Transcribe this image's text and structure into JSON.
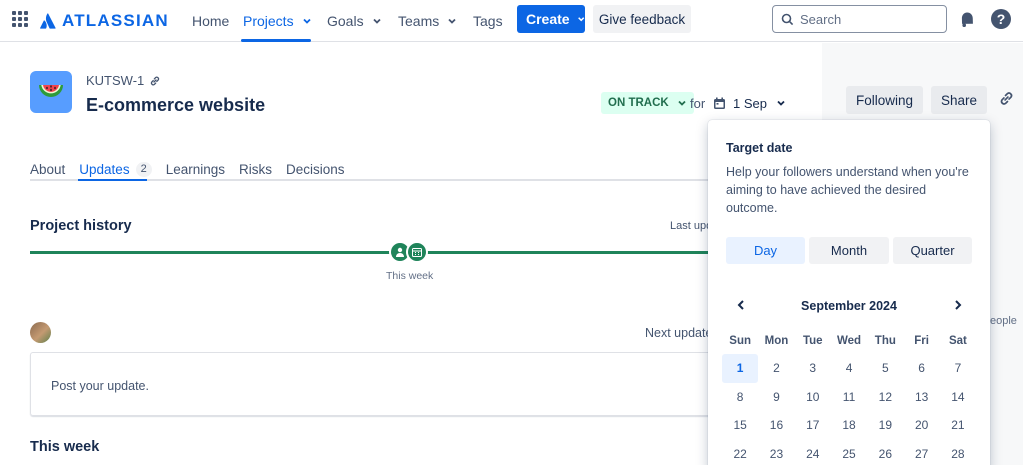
{
  "nav": {
    "logo": "ATLASSIAN",
    "items": [
      {
        "label": "Home"
      },
      {
        "label": "Projects"
      },
      {
        "label": "Goals"
      },
      {
        "label": "Teams"
      },
      {
        "label": "Tags"
      }
    ],
    "create_label": "Create",
    "feedback_label": "Give feedback",
    "search_placeholder": "Search"
  },
  "project": {
    "key": "KUTSW-1",
    "title": "E-commerce website",
    "status": "ON TRACK",
    "for_label": "for",
    "target_date": "1 Sep"
  },
  "actions": {
    "following": "Following",
    "share": "Share"
  },
  "tabs": [
    {
      "label": "About"
    },
    {
      "label": "Updates",
      "badge": "2"
    },
    {
      "label": "Learnings"
    },
    {
      "label": "Risks"
    },
    {
      "label": "Decisions"
    }
  ],
  "history": {
    "title": "Project history",
    "last_updated": "Last updated",
    "marker_label": "This week"
  },
  "update": {
    "next_update": "Next update",
    "post_placeholder": "Post your update.",
    "section_title": "This week"
  },
  "side": {
    "people_tail": "eople"
  },
  "popup": {
    "title": "Target date",
    "description": "Help your followers understand when you're aiming to have achieved the desired outcome.",
    "segments": [
      "Day",
      "Month",
      "Quarter"
    ],
    "active_segment": "Day",
    "month_label": "September 2024",
    "weekdays": [
      "Sun",
      "Mon",
      "Tue",
      "Wed",
      "Thu",
      "Fri",
      "Sat"
    ],
    "weeks": [
      [
        "1",
        "2",
        "3",
        "4",
        "5",
        "6",
        "7"
      ],
      [
        "8",
        "9",
        "10",
        "11",
        "12",
        "13",
        "14"
      ],
      [
        "15",
        "16",
        "17",
        "18",
        "19",
        "20",
        "21"
      ],
      [
        "22",
        "23",
        "24",
        "25",
        "26",
        "27",
        "28"
      ]
    ],
    "selected_day": "1"
  },
  "colors": {
    "brand": "#0c66e4",
    "on_track_bg": "#dcfff1",
    "on_track_text": "#216e4e",
    "timeline": "#1f845a"
  }
}
